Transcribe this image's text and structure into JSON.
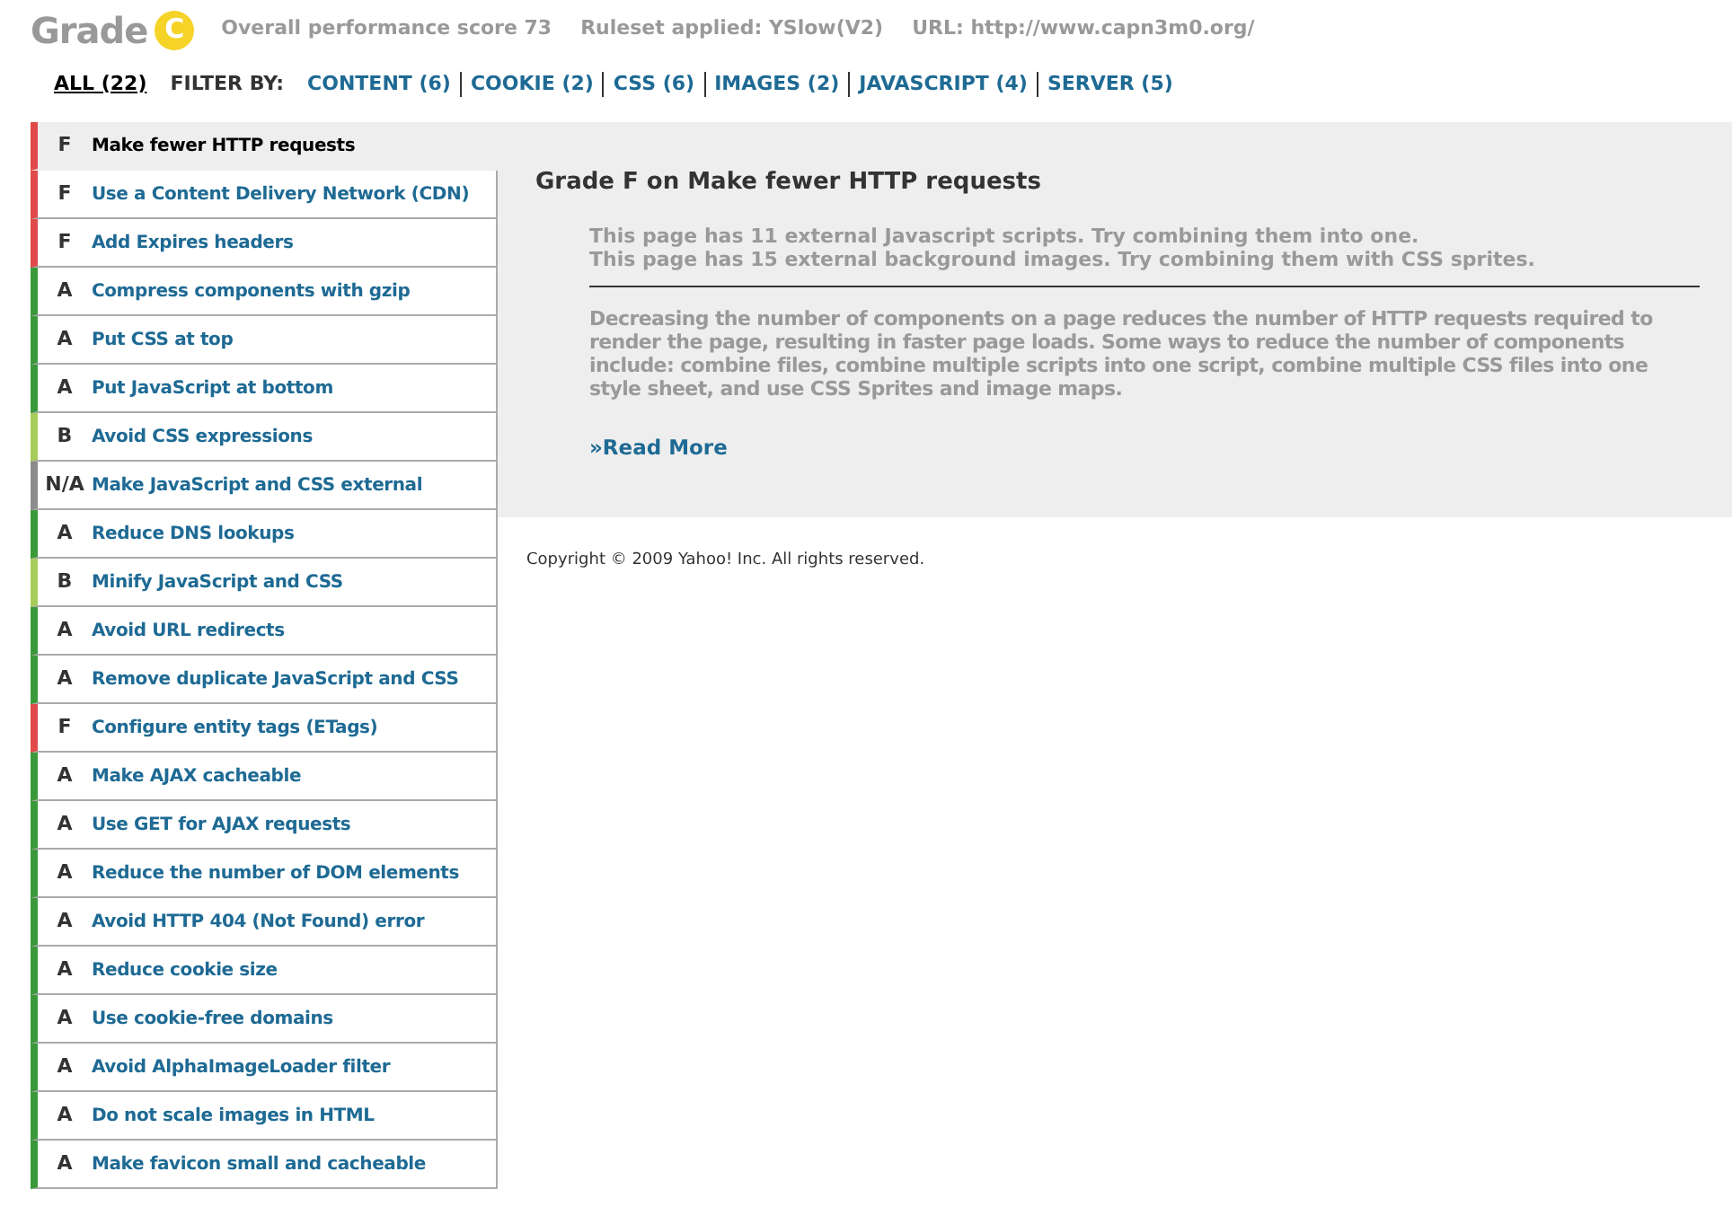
{
  "header": {
    "label": "Grade",
    "grade": "C",
    "score": "Overall performance score 73",
    "ruleset": "Ruleset applied: YSlow(V2)",
    "url": "URL: http://www.capn3m0.org/"
  },
  "filters": [
    {
      "label": "ALL (22)",
      "kind": "tab",
      "selected": true
    },
    {
      "label": "FILTER BY:",
      "kind": "caption"
    },
    {
      "label": "CONTENT (6)",
      "kind": "tab",
      "selected": false
    },
    {
      "label": "COOKIE (2)",
      "kind": "tab",
      "selected": false
    },
    {
      "label": "CSS (6)",
      "kind": "tab",
      "selected": false
    },
    {
      "label": "IMAGES (2)",
      "kind": "tab",
      "selected": false
    },
    {
      "label": "JAVASCRIPT (4)",
      "kind": "tab",
      "selected": false
    },
    {
      "label": "SERVER (5)",
      "kind": "tab",
      "selected": false
    }
  ],
  "rules": [
    {
      "grade": "F",
      "label": "Make fewer HTTP requests",
      "color": "#e04a4a",
      "selected": true
    },
    {
      "grade": "F",
      "label": "Use a Content Delivery Network (CDN)",
      "color": "#e04a4a",
      "selected": false
    },
    {
      "grade": "F",
      "label": "Add Expires headers",
      "color": "#e04a4a",
      "selected": false
    },
    {
      "grade": "A",
      "label": "Compress components with gzip",
      "color": "#3a9a3a",
      "selected": false
    },
    {
      "grade": "A",
      "label": "Put CSS at top",
      "color": "#3a9a3a",
      "selected": false
    },
    {
      "grade": "A",
      "label": "Put JavaScript at bottom",
      "color": "#3a9a3a",
      "selected": false
    },
    {
      "grade": "B",
      "label": "Avoid CSS expressions",
      "color": "#a8cc5a",
      "selected": false
    },
    {
      "grade": "N/A",
      "label": "Make JavaScript and CSS external",
      "color": "#8c8c8c",
      "selected": false
    },
    {
      "grade": "A",
      "label": "Reduce DNS lookups",
      "color": "#3a9a3a",
      "selected": false
    },
    {
      "grade": "B",
      "label": "Minify JavaScript and CSS",
      "color": "#a8cc5a",
      "selected": false
    },
    {
      "grade": "A",
      "label": "Avoid URL redirects",
      "color": "#3a9a3a",
      "selected": false
    },
    {
      "grade": "A",
      "label": "Remove duplicate JavaScript and CSS",
      "color": "#3a9a3a",
      "selected": false
    },
    {
      "grade": "F",
      "label": "Configure entity tags (ETags)",
      "color": "#e04a4a",
      "selected": false
    },
    {
      "grade": "A",
      "label": "Make AJAX cacheable",
      "color": "#3a9a3a",
      "selected": false
    },
    {
      "grade": "A",
      "label": "Use GET for AJAX requests",
      "color": "#3a9a3a",
      "selected": false
    },
    {
      "grade": "A",
      "label": "Reduce the number of DOM elements",
      "color": "#3a9a3a",
      "selected": false
    },
    {
      "grade": "A",
      "label": "Avoid HTTP 404 (Not Found) error",
      "color": "#3a9a3a",
      "selected": false
    },
    {
      "grade": "A",
      "label": "Reduce cookie size",
      "color": "#3a9a3a",
      "selected": false
    },
    {
      "grade": "A",
      "label": "Use cookie-free domains",
      "color": "#3a9a3a",
      "selected": false
    },
    {
      "grade": "A",
      "label": "Avoid AlphaImageLoader filter",
      "color": "#3a9a3a",
      "selected": false
    },
    {
      "grade": "A",
      "label": "Do not scale images in HTML",
      "color": "#3a9a3a",
      "selected": false
    },
    {
      "grade": "A",
      "label": "Make favicon small and cacheable",
      "color": "#3a9a3a",
      "selected": false
    }
  ],
  "detail": {
    "title": "Grade F on Make fewer HTTP requests",
    "findings": [
      "This page has 11 external Javascript scripts. Try combining them into one.",
      "This page has 15 external background images. Try combining them with CSS sprites."
    ],
    "description": "Decreasing the number of components on a page reduces the number of HTTP requests required to render the page, resulting in faster page loads. Some ways to reduce the number of components include: combine files, combine multiple scripts into one script, combine multiple CSS files into one style sheet, and use CSS Sprites and image maps.",
    "link": "»Read More"
  },
  "footer": "Copyright © 2009 Yahoo! Inc. All rights reserved."
}
